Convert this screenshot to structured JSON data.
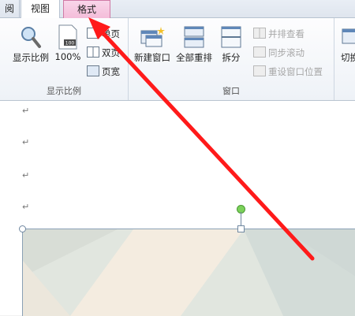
{
  "tabs": {
    "prev_partial": "阅",
    "view": "视图",
    "format": "格式"
  },
  "zoom_group": {
    "label": "显示比例",
    "zoom_button": "显示比例",
    "percent_button": "100%",
    "percent_icon_text": "100",
    "single_page": "单页",
    "two_pages": "双页",
    "page_width": "页宽"
  },
  "window_group": {
    "label": "窗口",
    "new_window": "新建窗口",
    "arrange_all": "全部重排",
    "split": "拆分",
    "side_by_side": "并排查看",
    "sync_scroll": "同步滚动",
    "reset_position": "重设窗口位置",
    "switch_partial": "切换"
  },
  "document": {
    "paragraph_mark": "↵"
  },
  "colors": {
    "arrow": "#ff1a1a",
    "format_tab": "#f4bdd9"
  }
}
